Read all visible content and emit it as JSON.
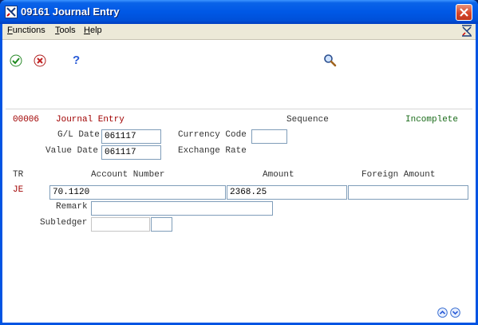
{
  "window": {
    "title": "09161   Journal Entry"
  },
  "menu": {
    "functions": "Functions",
    "tools": "Tools",
    "help": "Help"
  },
  "toolbar": {
    "ok_icon": "check-icon",
    "cancel_icon": "cancel-icon",
    "help_icon": "question-icon",
    "find_icon": "magnifier-icon"
  },
  "header": {
    "batch_number": "00006",
    "form_title": "Journal Entry",
    "sequence_label": "Sequence",
    "status": "Incomplete",
    "gl_date_label": "G/L Date",
    "gl_date_value": "061117",
    "value_date_label": "Value Date",
    "value_date_value": "061117",
    "currency_code_label": "Currency Code",
    "currency_code_value": "",
    "exchange_rate_label": "Exchange Rate"
  },
  "grid": {
    "tr_label": "TR",
    "account_number_label": "Account Number",
    "amount_label": "Amount",
    "foreign_amount_label": "Foreign Amount",
    "row": {
      "tr": "JE",
      "account_number": "70.1120",
      "amount": "2368.25",
      "foreign_amount": ""
    },
    "remark_label": "Remark",
    "remark_value": "",
    "subledger_label": "Subledger",
    "subledger_value": "",
    "subledger_type_value": ""
  },
  "colors": {
    "titlebar": "#0058e6",
    "accent_red": "#a00000",
    "status_green": "#1a6b1a"
  }
}
